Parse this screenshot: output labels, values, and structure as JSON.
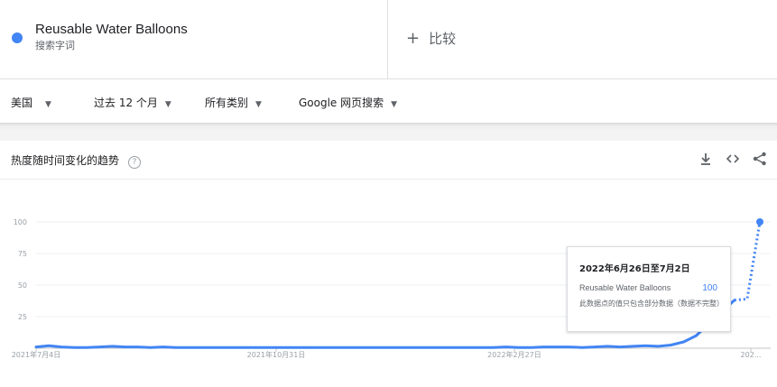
{
  "term": {
    "name": "Reusable Water Balloons",
    "subtitle": "搜索字词",
    "color": "#4285f4"
  },
  "compare": {
    "label": "比较"
  },
  "filters": [
    {
      "label": "美国"
    },
    {
      "label": "过去 12 个月"
    },
    {
      "label": "所有类别"
    },
    {
      "label": "Google 网页搜索"
    }
  ],
  "section": {
    "title": "热度随时间变化的趋势",
    "help_icon": "?"
  },
  "tools": [
    "download-icon",
    "embed-icon",
    "share-icon"
  ],
  "tooltip": {
    "date": "2022年6月26日至7月2日",
    "term": "Reusable Water Balloons",
    "value": "100",
    "note": "此数据点的值只包含部分数据（数据不完整）"
  },
  "chart_data": {
    "type": "line",
    "ylim": [
      0,
      100
    ],
    "yticks": [
      "100",
      "75",
      "50",
      "25"
    ],
    "xticks": [
      "2021年7月4日",
      "2021年10月31日",
      "2022年2月27日",
      "202..."
    ],
    "grid": true,
    "series": [
      {
        "name": "Reusable Water Balloons",
        "color": "#4285f4",
        "values": [
          1,
          2,
          1,
          0.5,
          0.5,
          1,
          1.5,
          1,
          1,
          0.5,
          1,
          0.5,
          0.5,
          0.5,
          0.5,
          0.5,
          0.5,
          0.5,
          0.5,
          0.5,
          0.5,
          0.5,
          0.5,
          0.5,
          0.5,
          0.5,
          0.5,
          0.5,
          0.5,
          0.5,
          0.5,
          0.5,
          0.5,
          0.5,
          0.5,
          0.5,
          0.5,
          1,
          0.5,
          0.5,
          1,
          1,
          1,
          0.5,
          1,
          1.5,
          1,
          1.5,
          2,
          1.5,
          2.5,
          5,
          10,
          20,
          29,
          38,
          39,
          100
        ],
        "partial_from_index": 55
      }
    ]
  }
}
